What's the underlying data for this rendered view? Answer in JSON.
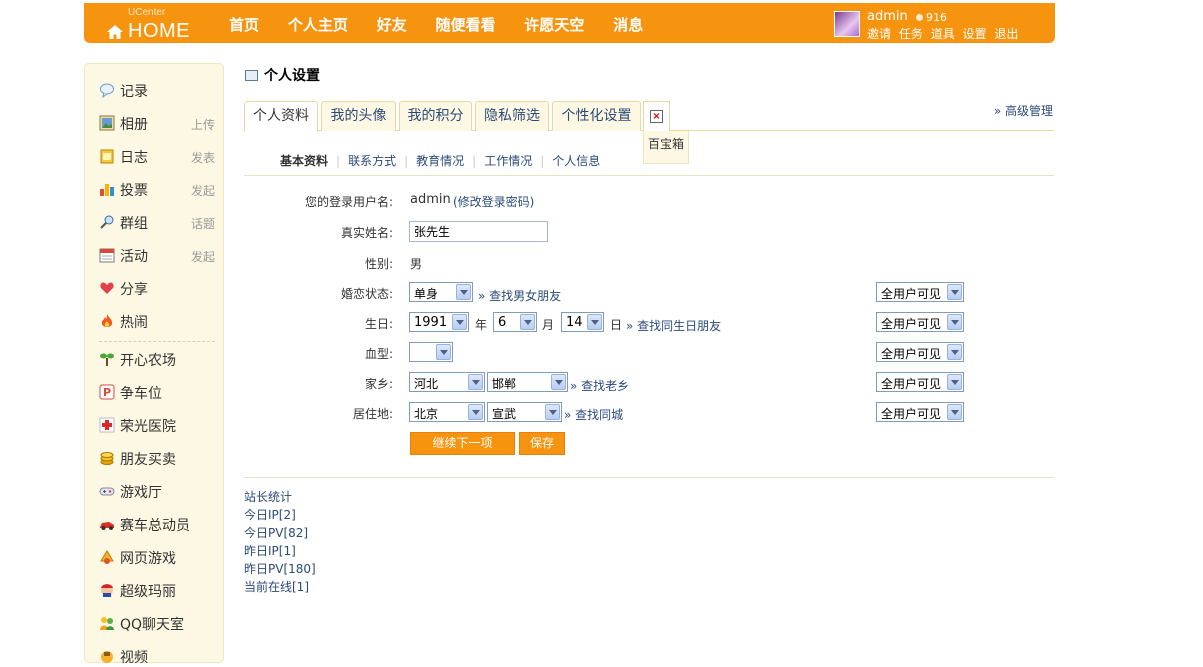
{
  "header": {
    "logo_small": "UCenter",
    "logo_big": "HOME",
    "nav": [
      "首页",
      "个人主页",
      "好友",
      "随便看看",
      "许愿天空",
      "消息"
    ],
    "user": {
      "name": "admin",
      "credit": "916",
      "menu": [
        "邀请",
        "任务",
        "道具",
        "设置",
        "退出"
      ]
    }
  },
  "sidebar": {
    "items": [
      {
        "label": "记录",
        "action": "",
        "icon": "speech-bubble-icon"
      },
      {
        "label": "相册",
        "action": "上传",
        "icon": "photo-icon"
      },
      {
        "label": "日志",
        "action": "发表",
        "icon": "notebook-icon"
      },
      {
        "label": "投票",
        "action": "发起",
        "icon": "bar-chart-icon"
      },
      {
        "label": "群组",
        "action": "话题",
        "icon": "group-icon"
      },
      {
        "label": "活动",
        "action": "发起",
        "icon": "calendar-icon"
      },
      {
        "label": "分享",
        "action": "",
        "icon": "heart-icon"
      },
      {
        "label": "热闹",
        "action": "",
        "icon": "fire-icon"
      },
      {
        "label": "开心农场",
        "action": "",
        "icon": "sprout-icon"
      },
      {
        "label": "争车位",
        "action": "",
        "icon": "parking-icon"
      },
      {
        "label": "荣光医院",
        "action": "",
        "icon": "red-cross-icon"
      },
      {
        "label": "朋友买卖",
        "action": "",
        "icon": "coins-icon"
      },
      {
        "label": "游戏厅",
        "action": "",
        "icon": "gamepad-icon"
      },
      {
        "label": "赛车总动员",
        "action": "",
        "icon": "racecar-icon"
      },
      {
        "label": "网页游戏",
        "action": "",
        "icon": "webgame-icon"
      },
      {
        "label": "超级玛丽",
        "action": "",
        "icon": "mario-icon"
      },
      {
        "label": "QQ聊天室",
        "action": "",
        "icon": "chat-people-icon"
      },
      {
        "label": "视频",
        "action": "",
        "icon": "video-icon"
      }
    ]
  },
  "main": {
    "title": "个人设置",
    "advanced": "» 高级管理",
    "tabs": [
      "个人资料",
      "我的头像",
      "我的积分",
      "隐私筛选",
      "个性化设置"
    ],
    "toolbox": "百宝箱",
    "subnav": [
      "基本资料",
      "联系方式",
      "教育情况",
      "工作情况",
      "个人信息"
    ],
    "form": {
      "login_label": "您的登录用户名:",
      "login_value": "admin",
      "login_link": "(修改登录密码)",
      "realname_label": "真实姓名:",
      "realname_value": "张先生",
      "gender_label": "性别:",
      "gender_value": "男",
      "marital_label": "婚恋状态:",
      "marital_value": "单身",
      "marital_link": "» 查找男女朋友",
      "birthday_label": "生日:",
      "birth_year": "1991",
      "year_unit": "年",
      "birth_month": "6",
      "month_unit": "月",
      "birth_day": "14",
      "day_unit": "日",
      "birthday_link": "» 查找同生日朋友",
      "blood_label": "血型:",
      "blood_value": "",
      "hometown_label": "家乡:",
      "hometown_province": "河北",
      "hometown_city": "邯郸",
      "hometown_link": "» 查找老乡",
      "residence_label": "居住地:",
      "residence_province": "北京",
      "residence_city": "宣武",
      "residence_link": "» 查找同城",
      "privacy_value": "全用户可见",
      "next_button": "继续下一项",
      "save_button": "保存"
    },
    "stats": [
      "站长统计",
      "今日IP[2]",
      "今日PV[82]",
      "昨日IP[1]",
      "昨日PV[180]",
      "当前在线[1]"
    ]
  },
  "colors": {
    "brand": "#f7940f",
    "link": "#2b4a78",
    "sidebar_bg": "#fdf8e4"
  }
}
